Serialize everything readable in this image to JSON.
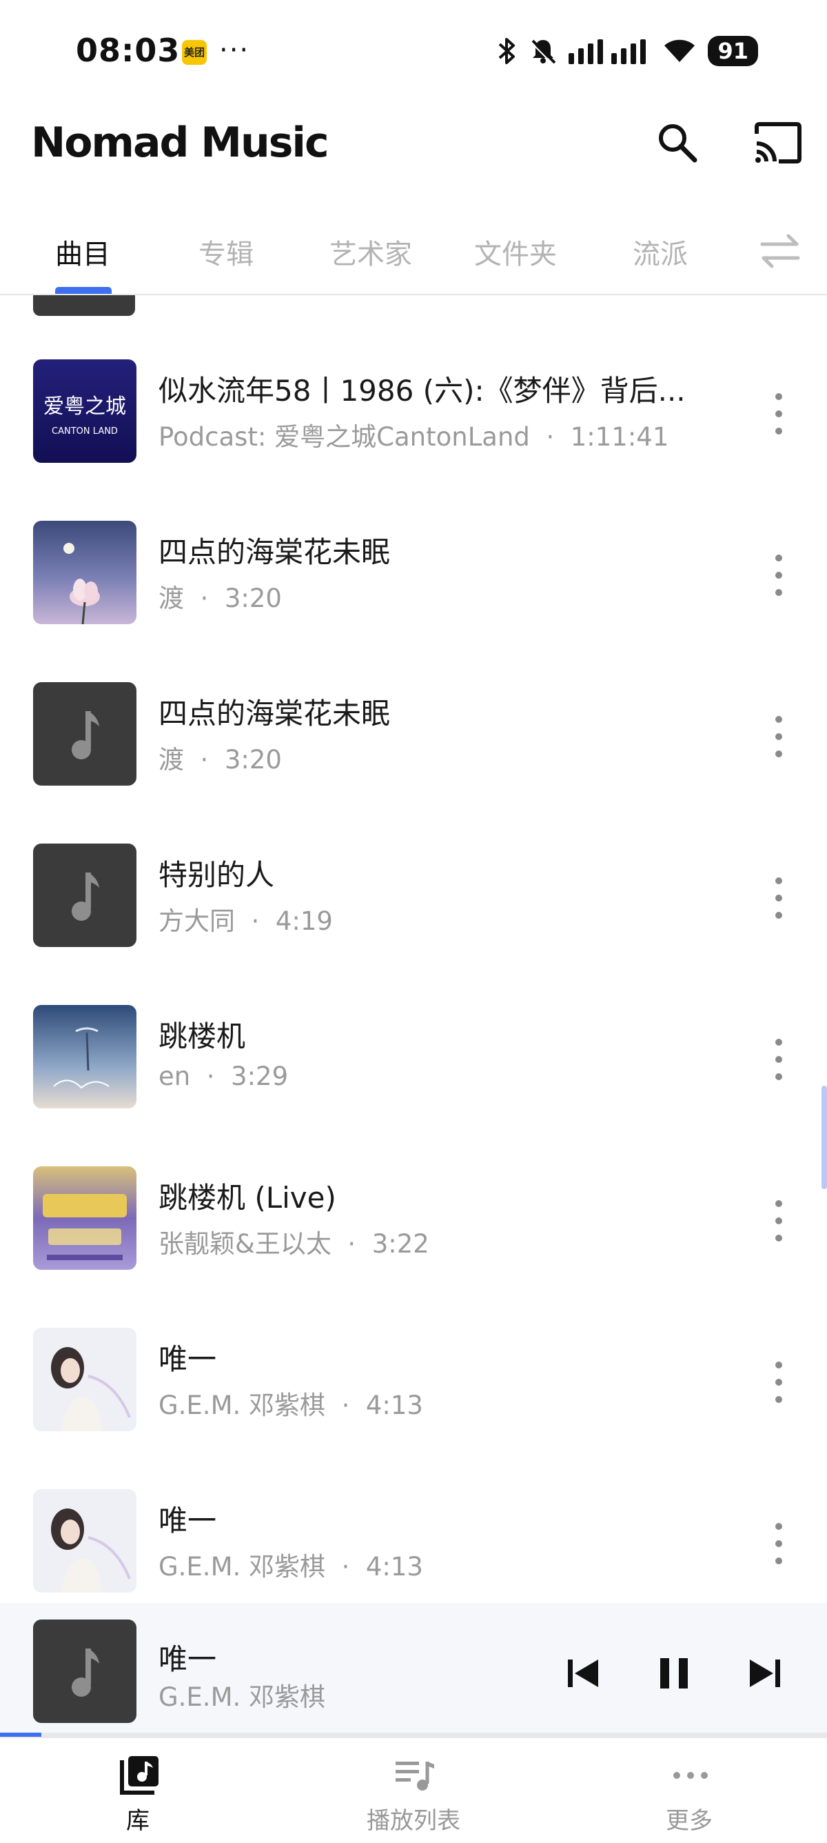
{
  "status_bar": {
    "time": "08:03",
    "notification_app": "美团",
    "more_notifications": "···",
    "battery": "91",
    "icons": [
      "bluetooth-icon",
      "bell-muted-icon",
      "signal-icon",
      "wifi-icon",
      "battery-icon"
    ]
  },
  "app_bar": {
    "title": "Nomad Music",
    "icons": [
      "search-icon",
      "cast-icon"
    ]
  },
  "tabs": [
    {
      "label": "曲目",
      "active": true
    },
    {
      "label": "专辑",
      "active": false
    },
    {
      "label": "艺术家",
      "active": false
    },
    {
      "label": "文件夹",
      "active": false
    },
    {
      "label": "流派",
      "active": false
    }
  ],
  "songs": [
    {
      "title": "似水流年58丨1986 (六):《梦伴》背后...",
      "artist": "Podcast: 爱粤之城CantonLand",
      "duration": "1:11:41",
      "art": "canton-land-cover",
      "art_text": "爱粤之城",
      "art_subtext": "CANTON LAND"
    },
    {
      "title": "四点的海棠花未眠",
      "artist": "渡",
      "duration": "3:20",
      "art": "flower-cover"
    },
    {
      "title": "四点的海棠花未眠",
      "artist": "渡",
      "duration": "3:20",
      "art": "placeholder"
    },
    {
      "title": "特别的人",
      "artist": "方大同",
      "duration": "4:19",
      "art": "placeholder"
    },
    {
      "title": "跳楼机",
      "artist": "en",
      "duration": "3:29",
      "art": "sky-cover"
    },
    {
      "title": "跳楼机 (Live)",
      "artist": "张靓颖&王以太",
      "duration": "3:22",
      "art": "show-cover"
    },
    {
      "title": "唯一",
      "artist": "G.E.M. 邓紫棋",
      "duration": "4:13",
      "art": "gem-cover"
    },
    {
      "title": "唯一",
      "artist": "G.E.M. 邓紫棋",
      "duration": "4:13",
      "art": "gem-cover"
    }
  ],
  "separator": "·",
  "now_playing": {
    "title": "唯一",
    "artist": "G.E.M. 邓紫棋",
    "progress": 0.05,
    "playing": true,
    "icons": [
      "skip-previous-icon",
      "pause-icon",
      "skip-next-icon"
    ]
  },
  "bottom_nav": [
    {
      "label": "库",
      "icon": "library-icon",
      "active": true
    },
    {
      "label": "播放列表",
      "icon": "playlist-icon",
      "active": false
    },
    {
      "label": "更多",
      "icon": "more-horizontal-icon",
      "active": false
    }
  ],
  "colors": {
    "accent": "#3d6ff0",
    "text_primary": "#1a1a1a",
    "text_secondary": "#9a9a9a",
    "placeholder_art": "#3b3b3b"
  }
}
